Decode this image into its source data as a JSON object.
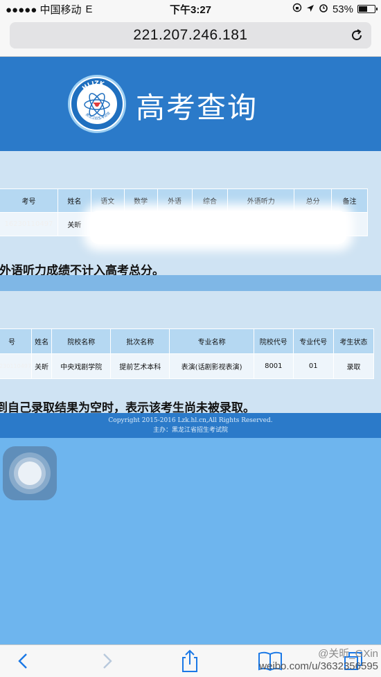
{
  "status_bar": {
    "carrier": "●●●●● 中国移动",
    "network": "E",
    "time": "下午3:27",
    "battery": "53%"
  },
  "browser": {
    "url": "221.207.246.181",
    "icons": [
      "reload-icon",
      "back-icon",
      "forward-icon",
      "share-icon",
      "bookmarks-icon",
      "tabs-icon"
    ]
  },
  "header": {
    "logo_text": "HLJZK",
    "logo_subtext": "黑龙江招生考试信息港",
    "title": "高考查询",
    "bg_color": "#2b7ac9"
  },
  "scores_table": {
    "headers": [
      "考号",
      "姓名",
      "语文",
      "数学",
      "外语",
      "综合",
      "外语听力",
      "总分",
      "备注"
    ],
    "row": [
      "16230110497",
      "关昕",
      "",
      "",
      "",
      "",
      "",
      "",
      ""
    ]
  },
  "scores_note": "外语听力成绩不计入高考总分。",
  "admission_table": {
    "headers": [
      "号",
      "姓名",
      "院校名称",
      "批次名称",
      "专业名称",
      "院校代号",
      "专业代号",
      "考生状态"
    ],
    "row": [
      "16230110497",
      "关昕",
      "中央戏剧学院",
      "提前艺术本科",
      "表演(话剧影视表演)",
      "8001",
      "01",
      "录取"
    ]
  },
  "admission_note": "到自己录取结果为空时，表示该考生尚未被录取。",
  "footer": {
    "copyright": "Copyright 2015-2016 Lzk.hl.cn,All Rights Reserved.",
    "sponsor": "主办：黑龙江省招生考试院"
  },
  "watermark": {
    "handle": "@关昕_GXin",
    "url": "weibo.com/u/3632356595"
  }
}
